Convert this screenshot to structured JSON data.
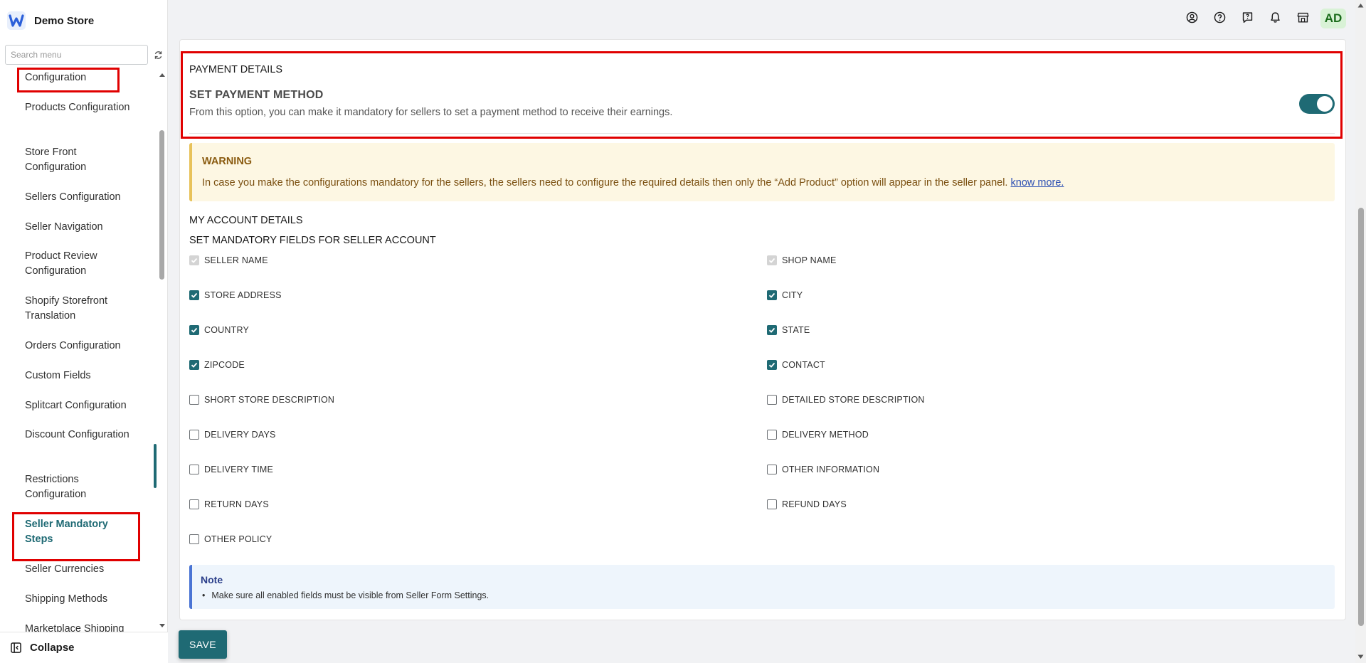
{
  "brand": {
    "name": "Demo Store"
  },
  "search": {
    "placeholder": "Search menu"
  },
  "menu": {
    "items": [
      {
        "label": "Configuration"
      },
      {
        "label": "Products Configuration"
      },
      {
        "label": "Store Front Configuration"
      },
      {
        "label": "Sellers Configuration"
      },
      {
        "label": "Seller Navigation"
      },
      {
        "label": "Product Review Configuration"
      },
      {
        "label": "Shopify Storefront Translation"
      },
      {
        "label": "Orders Configuration"
      },
      {
        "label": "Custom Fields"
      },
      {
        "label": "Splitcart Configuration"
      },
      {
        "label": "Discount Configuration"
      },
      {
        "label": "Restrictions Configuration"
      },
      {
        "label": "Seller Mandatory Steps"
      },
      {
        "label": "Seller Currencies"
      },
      {
        "label": "Shipping Methods"
      },
      {
        "label": "Marketplace Shipping"
      }
    ],
    "active_index": 12,
    "collapse_label": "Collapse"
  },
  "topbar": {
    "icons": [
      "account-circle-icon",
      "help-icon",
      "feedback-icon",
      "bell-icon",
      "store-icon"
    ],
    "avatar_initials": "AD"
  },
  "payment": {
    "section_title": "PAYMENT DETAILS",
    "heading": "SET PAYMENT METHOD",
    "description": "From this option, you can make it mandatory for sellers to set a payment method to receive their earnings.",
    "toggle_on": true
  },
  "warning": {
    "title": "WARNING",
    "text": "In case you make the configurations mandatory for the sellers, the sellers need to configure the required details then only the “Add Product” option will appear in the seller panel.",
    "link": "know more."
  },
  "account": {
    "section_title": "MY ACCOUNT DETAILS",
    "subtitle": "SET MANDATORY FIELDS FOR SELLER ACCOUNT",
    "fields": [
      {
        "label": "SELLER NAME",
        "state": "disabled"
      },
      {
        "label": "SHOP NAME",
        "state": "disabled"
      },
      {
        "label": "STORE ADDRESS",
        "state": "checked"
      },
      {
        "label": "CITY",
        "state": "checked"
      },
      {
        "label": "COUNTRY",
        "state": "checked"
      },
      {
        "label": "STATE",
        "state": "checked"
      },
      {
        "label": "ZIPCODE",
        "state": "checked"
      },
      {
        "label": "CONTACT",
        "state": "checked"
      },
      {
        "label": "SHORT STORE DESCRIPTION",
        "state": "unchecked"
      },
      {
        "label": "DETAILED STORE DESCRIPTION",
        "state": "unchecked"
      },
      {
        "label": "DELIVERY DAYS",
        "state": "unchecked"
      },
      {
        "label": "DELIVERY METHOD",
        "state": "unchecked"
      },
      {
        "label": "DELIVERY TIME",
        "state": "unchecked"
      },
      {
        "label": "OTHER INFORMATION",
        "state": "unchecked"
      },
      {
        "label": "RETURN DAYS",
        "state": "unchecked"
      },
      {
        "label": "REFUND DAYS",
        "state": "unchecked"
      },
      {
        "label": "OTHER POLICY",
        "state": "unchecked"
      }
    ]
  },
  "note": {
    "title": "Note",
    "text": "Make sure all enabled fields must be visible from Seller Form Settings."
  },
  "save_label": "SAVE",
  "colors": {
    "accent": "#1f6a74",
    "highlight": "#e00000",
    "warning_bg": "#fdf7e3",
    "note_bg": "#eef5fc"
  }
}
